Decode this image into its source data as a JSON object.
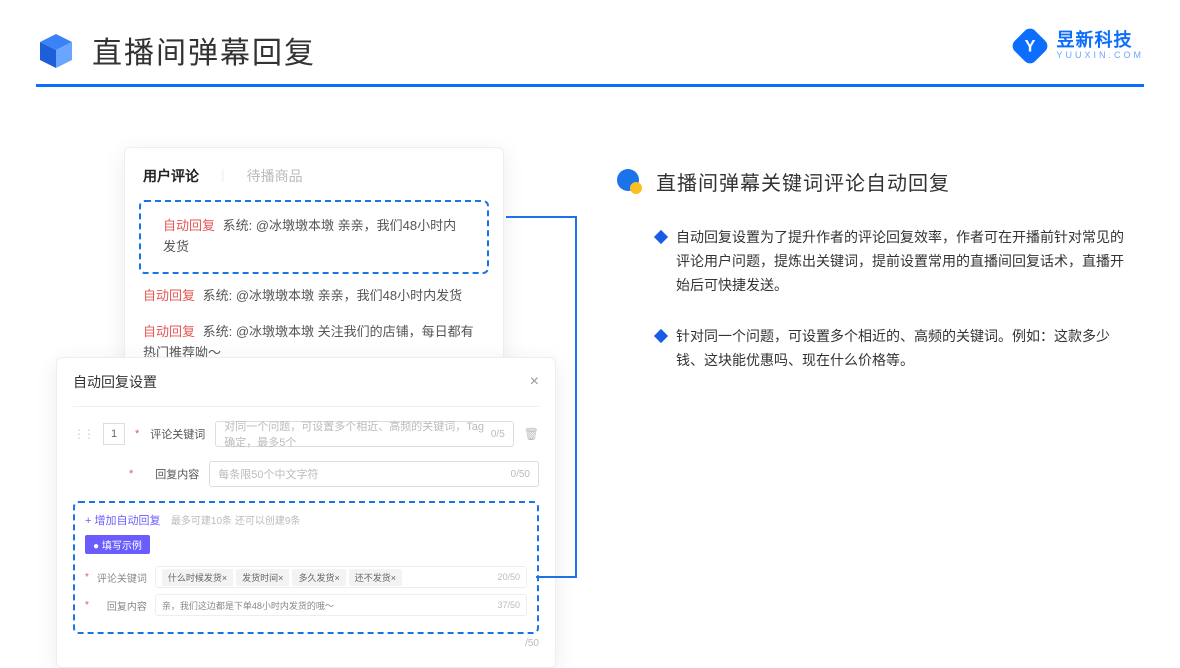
{
  "header": {
    "title": "直播间弹幕回复"
  },
  "brand": {
    "cn": "昱新科技",
    "en": "YUUXIN.COM"
  },
  "card_top": {
    "tab_active": "用户评论",
    "tab_inactive": "待播商品",
    "comment1_tag": "自动回复",
    "comment1_text": "系统: @冰墩墩本墩 亲亲，我们48小时内发货",
    "comment2_tag": "自动回复",
    "comment2_text": "系统: @冰墩墩本墩 亲亲，我们48小时内发货",
    "comment3_tag": "自动回复",
    "comment3_text": "系统: @冰墩墩本墩 关注我们的店铺，每日都有热门推荐呦～"
  },
  "modal": {
    "title": "自动回复设置",
    "index": "1",
    "label_keyword": "评论关键词",
    "placeholder_keyword": "对同一个问题，可设置多个相近、高频的关键词，Tag确定，最多5个",
    "count_keyword": "0/5",
    "label_content": "回复内容",
    "placeholder_content": "每条限50个中文字符",
    "count_content": "0/50",
    "add_text": "+ 增加自动回复",
    "add_hint": "最多可建10条 还可以创建9条",
    "example_badge": "● 填写示例",
    "ex_keyword_label": "评论关键词",
    "ex_tags": [
      "什么时候发货×",
      "发货时间×",
      "多久发货×",
      "还不发货×"
    ],
    "ex_keyword_count": "20/50",
    "ex_content_label": "回复内容",
    "ex_content_text": "亲，我们这边都是下单48小时内发货的哦～",
    "ex_content_count": "37/50",
    "footer_count": "/50"
  },
  "right": {
    "title": "直播间弹幕关键词评论自动回复",
    "bullet1": "自动回复设置为了提升作者的评论回复效率，作者可在开播前针对常见的评论用户问题，提炼出关键词，提前设置常用的直播间回复话术，直播开始后可快捷发送。",
    "bullet2": "针对同一个问题，可设置多个相近的、高频的关键词。例如：这款多少钱、这块能优惠吗、现在什么价格等。"
  }
}
